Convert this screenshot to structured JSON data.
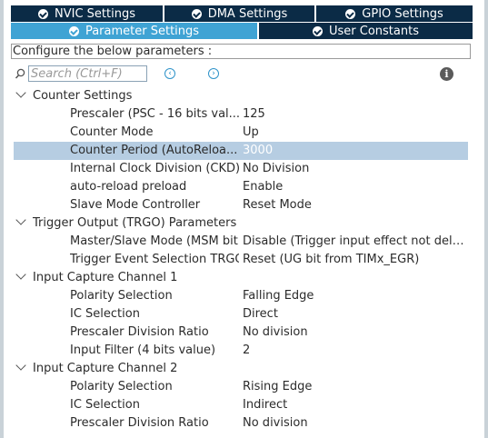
{
  "tabs_top": [
    {
      "label": "NVIC Settings"
    },
    {
      "label": "DMA Settings"
    },
    {
      "label": "GPIO Settings"
    }
  ],
  "tabs_bottom": [
    {
      "label": "Parameter Settings",
      "active": true
    },
    {
      "label": "User Constants",
      "active": false
    }
  ],
  "config_label": "Configure the below parameters :",
  "search": {
    "placeholder": "Search (Ctrl+F)",
    "value": ""
  },
  "nav": {
    "prev_icon": "chevron-left-icon",
    "next_icon": "chevron-right-icon"
  },
  "info_glyph": "i",
  "groups": [
    {
      "title": "Counter Settings",
      "params": [
        {
          "name": "Prescaler (PSC - 16 bits val...",
          "value": "125"
        },
        {
          "name": "Counter Mode",
          "value": "Up"
        },
        {
          "name": "Counter Period (AutoReloa...",
          "value": "3000",
          "selected": true
        },
        {
          "name": "Internal Clock Division (CKD)",
          "value": "No Division"
        },
        {
          "name": "auto-reload preload",
          "value": "Enable"
        },
        {
          "name": "Slave Mode Controller",
          "value": "Reset Mode"
        }
      ]
    },
    {
      "title": "Trigger Output (TRGO) Parameters",
      "params": [
        {
          "name": "Master/Slave Mode (MSM bit)",
          "value": "Disable (Trigger input effect not dela..."
        },
        {
          "name": "Trigger Event Selection TRGO",
          "value": "Reset (UG bit from TIMx_EGR)"
        }
      ]
    },
    {
      "title": "Input Capture Channel 1",
      "params": [
        {
          "name": "Polarity Selection",
          "value": "Falling Edge"
        },
        {
          "name": "IC Selection",
          "value": "Direct"
        },
        {
          "name": "Prescaler Division Ratio",
          "value": "No division"
        },
        {
          "name": "Input Filter (4 bits value)",
          "value": "2"
        }
      ]
    },
    {
      "title": "Input Capture Channel 2",
      "params": [
        {
          "name": "Polarity Selection",
          "value": "Rising Edge"
        },
        {
          "name": "IC Selection",
          "value": "Indirect"
        },
        {
          "name": "Prescaler Division Ratio",
          "value": "No division"
        }
      ]
    }
  ],
  "colors": {
    "tab_bg": "#0b2b46",
    "tab_active_bg": "#3fa3d4",
    "selected_row": "#b6cde2"
  }
}
